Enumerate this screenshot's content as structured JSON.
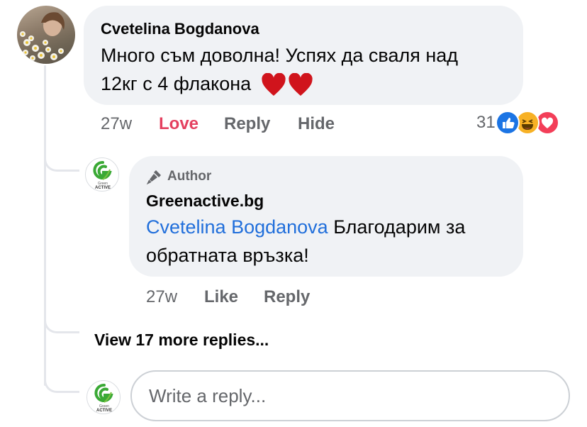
{
  "comment": {
    "author": "Cvetelina Bogdanova",
    "text_line1": "Много съм доволна! Успях да сваля над",
    "text_line2": "12кг с 4 флакона",
    "hearts": "❤️❤️",
    "time": "27w",
    "actions": {
      "love": "Love",
      "reply": "Reply",
      "hide": "Hide"
    },
    "reaction_count": "31",
    "reaction_icons": [
      "like-icon",
      "haha-icon",
      "love-icon"
    ]
  },
  "reply": {
    "badge": "Author",
    "page_name": "Greenactive.bg",
    "mention": "Cvetelina Bogdanova",
    "text_after_mention": " Благодарим за",
    "text_line2": "обратната връзка!",
    "time": "27w",
    "actions": {
      "like": "Like",
      "reply": "Reply"
    },
    "logo_text_top": "Green",
    "logo_text_bottom": "ACTIVE"
  },
  "view_more": "View 17 more replies...",
  "composer": {
    "placeholder": "Write a reply..."
  },
  "colors": {
    "bubble": "#f0f2f5",
    "meta": "#65676b",
    "love": "#e4405f",
    "link": "#216fdb",
    "brand_green": "#3aa935"
  }
}
